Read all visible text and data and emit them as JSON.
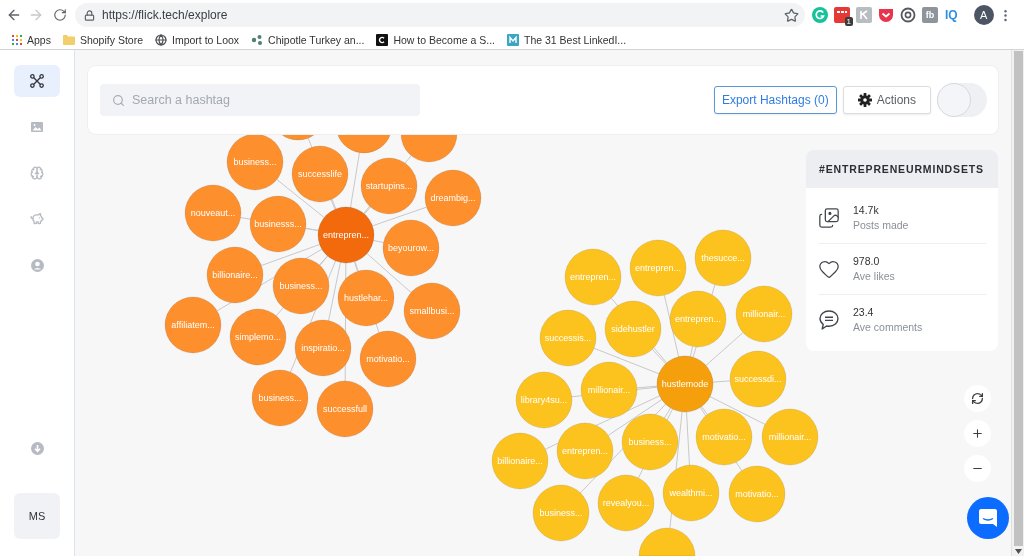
{
  "browser": {
    "url": "https://flick.tech/explore",
    "forward_disabled": true,
    "extensions": [
      {
        "kind": "grammar"
      },
      {
        "kind": "calendar",
        "badge": "1"
      },
      {
        "kind": "tile"
      },
      {
        "kind": "pocket"
      },
      {
        "kind": "target"
      },
      {
        "kind": "text-tile",
        "text": "fb"
      },
      {
        "kind": "text",
        "text": "IQ"
      }
    ],
    "profile_initial": "A",
    "bookmarks": [
      {
        "label": "Apps"
      },
      {
        "label": "Shopify Store"
      },
      {
        "label": "Import to Loox"
      },
      {
        "label": "Chipotle Turkey an..."
      },
      {
        "label": "How to Become a S..."
      },
      {
        "label": "The 31 Best LinkedI..."
      }
    ]
  },
  "sidebar": {
    "items": [
      {
        "selected": true
      },
      {
        "selected": false
      },
      {
        "selected": false
      },
      {
        "selected": false
      },
      {
        "selected": false
      }
    ],
    "user_initials": "MS"
  },
  "toolbar": {
    "search": {
      "placeholder": "Search a hashtag"
    },
    "buttons": [
      {
        "label": "Export Hashtags (0)",
        "kind": "outline"
      },
      {
        "label": "Actions",
        "kind": "menu"
      }
    ],
    "toggle": {
      "on": false
    }
  },
  "graph": {
    "clusters": [
      {
        "color": "#fd8f2c",
        "hub": {
          "label": "entrepren...",
          "color": "#f36a0d"
        },
        "nodes": [
          {
            "covered": true
          },
          {
            "covered": true
          },
          {
            "covered": true
          },
          {
            "label": "business...",
            "covered": false
          },
          {
            "label": "successlife",
            "covered": false
          },
          {
            "label": "startupins...",
            "covered": false
          },
          {
            "label": "dreambig...",
            "covered": false
          },
          {
            "label": "nouveaut...",
            "covered": false
          },
          {
            "label": "businesss...",
            "covered": false
          },
          {
            "label": "beyourow...",
            "covered": false
          },
          {
            "label": "billionaire...",
            "covered": false
          },
          {
            "label": "business...",
            "covered": false
          },
          {
            "label": "hustlehar...",
            "covered": false
          },
          {
            "label": "smallbusi...",
            "covered": false
          },
          {
            "label": "affiliatem...",
            "covered": false
          },
          {
            "label": "simplemo...",
            "covered": false
          },
          {
            "label": "inspiratio...",
            "covered": false
          },
          {
            "label": "motivatio...",
            "covered": false
          },
          {
            "label": "business...",
            "covered": false
          },
          {
            "label": "successfull",
            "covered": false
          }
        ]
      },
      {
        "color": "#fcc31f",
        "hub": {
          "label": "hustlemode",
          "color": "#f49f0b"
        },
        "nodes": [
          {
            "label": "entrepren...",
            "covered": false
          },
          {
            "label": "entrepren...",
            "covered": false
          },
          {
            "label": "thesucce...",
            "covered": false
          },
          {
            "label": "sidehustler",
            "covered": false
          },
          {
            "label": "entrepren...",
            "covered": false
          },
          {
            "label": "millionair...",
            "covered": false
          },
          {
            "label": "successis...",
            "covered": false
          },
          {
            "label": "millionair...",
            "covered": false
          },
          {
            "label": "successdi...",
            "covered": false
          },
          {
            "label": "library4su...",
            "covered": false
          },
          {
            "label": "millionair...",
            "covered": false
          },
          {
            "label": "motivatio...",
            "covered": false
          },
          {
            "label": "business...",
            "covered": false
          },
          {
            "label": "entrepren...",
            "covered": false
          },
          {
            "label": "billionaire...",
            "covered": false
          },
          {
            "label": "revealyou...",
            "covered": false
          },
          {
            "label": "wealthmi...",
            "covered": false
          },
          {
            "label": "motivatio...",
            "covered": false
          },
          {
            "label": "business...",
            "covered": false
          },
          {
            "covered": true
          }
        ]
      }
    ]
  },
  "stats_panel": {
    "title": "#ENTREPRENEURMINDSETS",
    "stats": [
      {
        "value": "14.7k",
        "label": "Posts made"
      },
      {
        "value": "978.0",
        "label": "Ave likes"
      },
      {
        "value": "23.4",
        "label": "Ave comments"
      }
    ]
  }
}
